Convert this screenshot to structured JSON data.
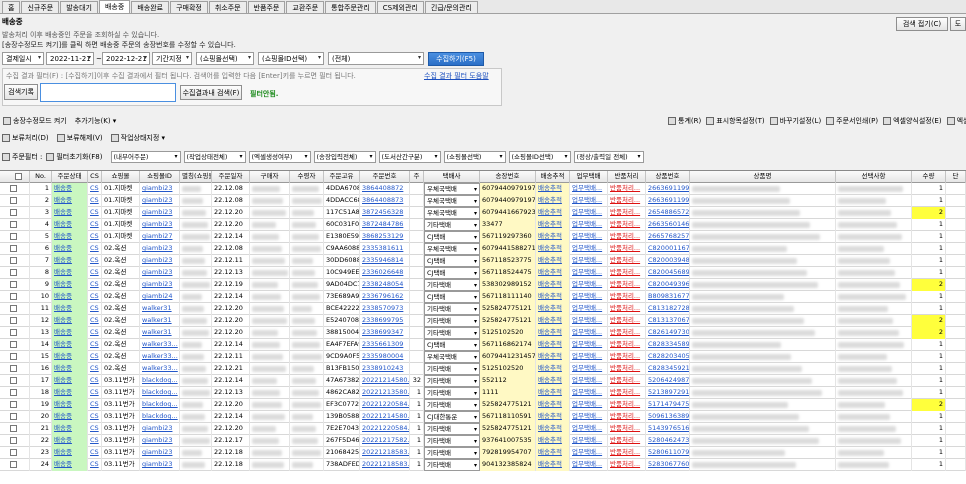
{
  "tabs": [
    "홈",
    "신규주문",
    "발송대기",
    "배송중",
    "배송완료",
    "구매확정",
    "취소주문",
    "반품주문",
    "교환주문",
    "통합주문관리",
    "CS제외관리",
    "긴급/문의관리"
  ],
  "active_tab": 3,
  "page": {
    "title": "배송중",
    "desc1": "발송처리 이후 배송중인 주문을 조회하실 수 있습니다.",
    "desc2": "[송장수정모드 켜기]를 클릭 하면 배송중 주문의 송장번호를 수정할 수 있습니다."
  },
  "top_buttons": {
    "collapse": "검색 접기(C)",
    "right": "도"
  },
  "search": {
    "date_type": "결제일시",
    "date_from": "2022-11-21",
    "date_sep": "~",
    "date_to": "2022-12-21",
    "period_label": "기간지정",
    "shop_select": "(쇼핑몰선택)",
    "shop_id_select": "(쇼핑몰ID선택)",
    "all_select": "(전체)",
    "collect_button": "수집하기(F5)"
  },
  "filter": {
    "hint": "수집 결과 필터(F) : [수집하기]이후 수집 결과에서 필터 됩니다. 검색어를 입력한 다음 [Enter]키를 누르면 필터 됩니다.",
    "help_link": "수집 결과 필터 도움말",
    "record_button": "검색기록",
    "filter_button": "수집결과내 검색(F)",
    "filter_status": "필터안됨."
  },
  "toolbar1": {
    "edit_mode": "송장수정모드 켜기",
    "add_function": "추가기능(K)",
    "right": [
      "통계(R)",
      "표시항목설정(T)",
      "바꾸기설정(L)",
      "주문서인쇄(P)",
      "엑셀양식설정(E)",
      "엑셀"
    ]
  },
  "toolbar2": {
    "hold": "보류처리(D)",
    "unhold": "보류해제(V)",
    "work_status": "작업상태지정"
  },
  "toolbar3": {
    "order_filter": "주문필터 :",
    "filter_reset": "필터초기화(F8)",
    "selects": [
      "(내부어주문)",
      "(작업상태전체)",
      "(엑셀생성여부)",
      "(송장입력전체)",
      "(도서산간구분)",
      "(쇼핑몰선택)",
      "(쇼핑몰ID선택)",
      "(정상/출력일 전체)"
    ]
  },
  "columns": [
    "No.",
    "주문상태",
    "CS",
    "쇼핑몰",
    "쇼핑몰ID",
    "별칭(쇼핑몰)",
    "주문일자",
    "구매자",
    "수령자",
    "주문고유",
    "주문번호",
    "주",
    "택배사",
    "송장번호",
    "배송추적",
    "업무택배",
    "반품처리",
    "상품번호",
    "상품명",
    "선택사항",
    "수량",
    "단"
  ],
  "rows": [
    {
      "no": "1",
      "status": "배송중",
      "cs": "CS",
      "shop": "01.지마켓",
      "shop_id": "giambi23",
      "date": "22.12.08",
      "uid": "4DDA67082",
      "ord": "3864408872",
      "ju": "",
      "courier": "우체국택배",
      "track": "6079440979197",
      "trk": "배송추적",
      "work": "업무택배...",
      "ret": "반품처리...",
      "pno": "2663691199",
      "qty": "1"
    },
    {
      "no": "2",
      "status": "배송중",
      "cs": "CS",
      "shop": "01.지마켓",
      "shop_id": "giambi23",
      "date": "22.12.08",
      "uid": "4DDACC683",
      "ord": "3864408873",
      "ju": "",
      "courier": "우체국택배",
      "track": "6079440979197",
      "trk": "배송추적",
      "work": "업무택배...",
      "ret": "반품처리...",
      "pno": "2663691199",
      "qty": "1"
    },
    {
      "no": "3",
      "status": "배송중",
      "cs": "CS",
      "shop": "01.지마켓",
      "shop_id": "giambi23",
      "date": "22.12.20",
      "uid": "117C51A80",
      "ord": "3872456328",
      "ju": "",
      "courier": "우체국택배",
      "track": "6079441667923",
      "trk": "배송추적",
      "work": "업무택배...",
      "ret": "반품처리...",
      "pno": "2654886572",
      "qty": "2"
    },
    {
      "no": "4",
      "status": "배송중",
      "cs": "CS",
      "shop": "01.지마켓",
      "shop_id": "giambi23",
      "date": "22.12.20",
      "uid": "60C031F06",
      "ord": "3872484786",
      "ju": "",
      "courier": "기타택배",
      "track": "33477",
      "trk": "배송추적",
      "work": "업무택배...",
      "ret": "반품처리...",
      "pno": "2663560146",
      "qty": "1"
    },
    {
      "no": "5",
      "status": "배송중",
      "cs": "CS",
      "shop": "01.지마켓",
      "shop_id": "giambi27",
      "date": "22.12.14",
      "uid": "E1380E599",
      "ord": "3868253129",
      "ju": "",
      "courier": "CJ택배",
      "track": "567119297360",
      "trk": "배송추적",
      "work": "업무택배...",
      "ret": "반품처리...",
      "pno": "2665768257",
      "qty": "1"
    },
    {
      "no": "6",
      "status": "배송중",
      "cs": "CS",
      "shop": "02.옥션",
      "shop_id": "giambi23",
      "date": "22.12.08",
      "uid": "C9AA60881",
      "ord": "2335381611",
      "ju": "",
      "courier": "우체국택배",
      "track": "6079441588271",
      "trk": "배송추적",
      "work": "업무택배...",
      "ret": "반품처리...",
      "pno": "C820001167",
      "qty": "1"
    },
    {
      "no": "7",
      "status": "배송중",
      "cs": "CS",
      "shop": "02.옥션",
      "shop_id": "giambi23",
      "date": "22.12.11",
      "uid": "30DD60884",
      "ord": "2335946814",
      "ju": "",
      "courier": "CJ택배",
      "track": "567118523775",
      "trk": "배송추적",
      "work": "업무택배...",
      "ret": "반품처리...",
      "pno": "C820003948",
      "qty": "1"
    },
    {
      "no": "8",
      "status": "배송중",
      "cs": "CS",
      "shop": "02.옥션",
      "shop_id": "giambi23",
      "date": "22.12.13",
      "uid": "10C949EE8",
      "ord": "2336026648",
      "ju": "",
      "courier": "CJ택배",
      "track": "567118524475",
      "trk": "배송추적",
      "work": "업무택배...",
      "ret": "반품처리...",
      "pno": "C820045689",
      "qty": "1"
    },
    {
      "no": "9",
      "status": "배송중",
      "cs": "CS",
      "shop": "02.옥션",
      "shop_id": "giambi23",
      "date": "22.12.19",
      "uid": "9AD04DC74",
      "ord": "2338248054",
      "ju": "",
      "courier": "기타택배",
      "track": "538302989152",
      "trk": "배송추적",
      "work": "업무택배...",
      "ret": "반품처리...",
      "pno": "C820049396",
      "qty": "2"
    },
    {
      "no": "10",
      "status": "배송중",
      "cs": "CS",
      "shop": "02.옥션",
      "shop_id": "giambi24",
      "date": "22.12.14",
      "uid": "73E689A92",
      "ord": "2336796162",
      "ju": "",
      "courier": "CJ택배",
      "track": "567118111140",
      "trk": "배송추적",
      "work": "업무택배...",
      "ret": "반품처리...",
      "pno": "B809831677",
      "qty": "1"
    },
    {
      "no": "11",
      "status": "배송중",
      "cs": "CS",
      "shop": "02.옥션",
      "shop_id": "walker31",
      "date": "22.12.20",
      "uid": "BCE422223",
      "ord": "2338570973",
      "ju": "",
      "courier": "기타택배",
      "track": "525824775121",
      "trk": "배송추적",
      "work": "업무택배...",
      "ret": "반품처리...",
      "pno": "C813182728",
      "qty": "1"
    },
    {
      "no": "12",
      "status": "배송중",
      "cs": "CS",
      "shop": "02.옥션",
      "shop_id": "walker31",
      "date": "22.12.20",
      "uid": "E52407085",
      "ord": "2338699795",
      "ju": "",
      "courier": "기타택배",
      "track": "525824775121",
      "trk": "배송추적",
      "work": "업무택배...",
      "ret": "반품처리...",
      "pno": "C813137067",
      "qty": "2"
    },
    {
      "no": "13",
      "status": "배송중",
      "cs": "CS",
      "shop": "02.옥션",
      "shop_id": "walker31",
      "date": "22.12.20",
      "uid": "388150047",
      "ord": "2338699347",
      "ju": "",
      "courier": "기타택배",
      "track": "5125102520",
      "trk": "배송추적",
      "work": "업무택배...",
      "ret": "반품처리...",
      "pno": "C826149730",
      "qty": "2"
    },
    {
      "no": "14",
      "status": "배송중",
      "cs": "CS",
      "shop": "02.옥션",
      "shop_id": "walker33...",
      "date": "22.12.14",
      "uid": "EA4F7EFA9",
      "ord": "2335661309",
      "ju": "",
      "courier": "CJ택배",
      "track": "567116862174",
      "trk": "배송추적",
      "work": "업무택배...",
      "ret": "반품처리...",
      "pno": "C828334589",
      "qty": "1"
    },
    {
      "no": "15",
      "status": "배송중",
      "cs": "CS",
      "shop": "02.옥션",
      "shop_id": "walker33...",
      "date": "22.12.11",
      "uid": "9CD9A0F54",
      "ord": "2335980004",
      "ju": "",
      "courier": "우체국택배",
      "track": "6079441231457",
      "trk": "배송추적",
      "work": "업무택배...",
      "ret": "반품처리...",
      "pno": "C828203405",
      "qty": "1"
    },
    {
      "no": "16",
      "status": "배송중",
      "cs": "CS",
      "shop": "02.옥션",
      "shop_id": "walker33...",
      "date": "22.12.21",
      "uid": "B13FB1503",
      "ord": "2338910243",
      "ju": "",
      "courier": "기타택배",
      "track": "5125102520",
      "trk": "배송추적",
      "work": "업무택배...",
      "ret": "반품처리...",
      "pno": "C828345921",
      "qty": "1"
    },
    {
      "no": "17",
      "status": "배송중",
      "cs": "CS",
      "shop": "03.11번가",
      "shop_id": "blackdog...",
      "date": "22.12.14",
      "uid": "47A673828",
      "ord": "20221214580...",
      "ju": "32",
      "courier": "기타택배",
      "track": "552112",
      "trk": "배송추적",
      "work": "업무택배...",
      "ret": "반품처리...",
      "pno": "5206424987",
      "qty": "1"
    },
    {
      "no": "18",
      "status": "배송중",
      "cs": "CS",
      "shop": "03.11번가",
      "shop_id": "blackdog...",
      "date": "22.12.13",
      "uid": "4862CA826",
      "ord": "20221213580...",
      "ju": "1",
      "courier": "기타택배",
      "track": "1111",
      "trk": "배송추적",
      "work": "업무택배...",
      "ret": "반품처리...",
      "pno": "5213897291",
      "qty": "1"
    },
    {
      "no": "19",
      "status": "배송중",
      "cs": "CS",
      "shop": "03.11번가",
      "shop_id": "blackdog...",
      "date": "22.12.20",
      "uid": "EF3C07724",
      "ord": "20221220584...",
      "ju": "1",
      "courier": "기타택배",
      "track": "525824775121",
      "trk": "배송추적",
      "work": "업무택배...",
      "ret": "반품처리...",
      "pno": "5171479475",
      "qty": "2"
    },
    {
      "no": "20",
      "status": "배송중",
      "cs": "CS",
      "shop": "03.11번가",
      "shop_id": "blackdog...",
      "date": "22.12.14",
      "uid": "139B05889",
      "ord": "20221214580...",
      "ju": "1",
      "courier": "CJ대한통운",
      "track": "567118110591",
      "trk": "배송추적",
      "work": "업무택배...",
      "ret": "반품처리...",
      "pno": "5096136389",
      "qty": "1"
    },
    {
      "no": "21",
      "status": "배송중",
      "cs": "CS",
      "shop": "03.11번가",
      "shop_id": "giambi23",
      "date": "22.12.20",
      "uid": "7E2E70437",
      "ord": "20221220584...",
      "ju": "1",
      "courier": "기타택배",
      "track": "525824775121",
      "trk": "배송추적",
      "work": "업무택배...",
      "ret": "반품처리...",
      "pno": "5143976516",
      "qty": "1"
    },
    {
      "no": "22",
      "status": "배송중",
      "cs": "CS",
      "shop": "03.11번가",
      "shop_id": "giambi23",
      "date": "22.12.17",
      "uid": "267F5D469",
      "ord": "20221217582...",
      "ju": "1",
      "courier": "기타택배",
      "track": "937641007535",
      "trk": "배송추적",
      "work": "업무택배...",
      "ret": "반품처리...",
      "pno": "5280462473",
      "qty": "1"
    },
    {
      "no": "23",
      "status": "배송중",
      "cs": "CS",
      "shop": "03.11번가",
      "shop_id": "giambi23",
      "date": "22.12.18",
      "uid": "210684254",
      "ord": "20221218583...",
      "ju": "1",
      "courier": "기타택배",
      "track": "792819954707",
      "trk": "배송추적",
      "work": "업무택배...",
      "ret": "반품처리...",
      "pno": "5280611079",
      "qty": "1"
    },
    {
      "no": "24",
      "status": "배송중",
      "cs": "CS",
      "shop": "03.11번가",
      "shop_id": "giambi23",
      "date": "22.12.18",
      "uid": "738ADFED8",
      "ord": "20221218583...",
      "ju": "1",
      "courier": "기타택배",
      "track": "904132385824",
      "trk": "배송추적",
      "work": "업무택배...",
      "ret": "반품처리...",
      "pno": "5283067760",
      "qty": "1"
    }
  ]
}
